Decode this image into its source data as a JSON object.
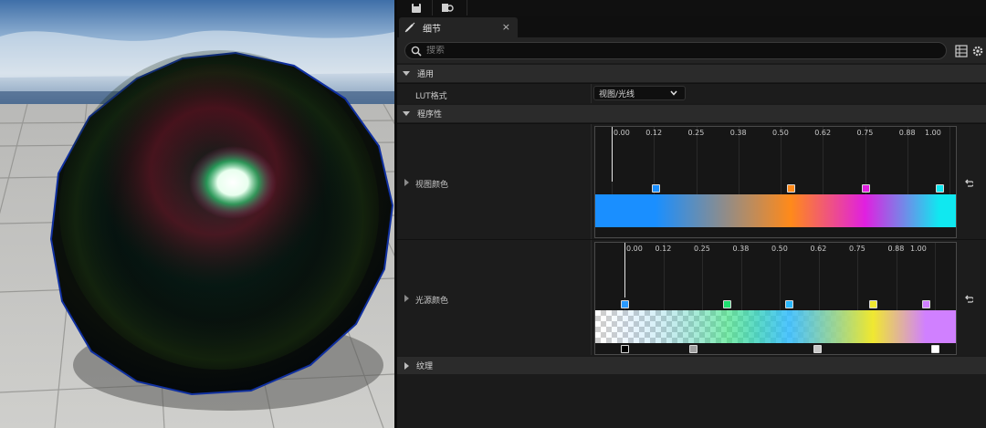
{
  "panel": {
    "tab_title": "细节",
    "tab_close": "×",
    "search_placeholder": "搜索"
  },
  "categories": {
    "general": "通用",
    "procedural": "程序性",
    "texture": "纹理"
  },
  "properties": {
    "lut_format": {
      "name": "LUT格式",
      "value": "视图/光线"
    },
    "view_color": {
      "name": "视图颜色",
      "ticks": [
        "0.00",
        "0.12",
        "0.25",
        "0.38",
        "0.50",
        "0.62",
        "0.75",
        "0.88",
        "1.00"
      ],
      "color_stops": [
        {
          "position": 0.13,
          "color": "#1a8fff"
        },
        {
          "position": 0.53,
          "color": "#ff8a1a"
        },
        {
          "position": 0.75,
          "color": "#e020e0"
        },
        {
          "position": 0.97,
          "color": "#10e8f0"
        }
      ]
    },
    "light_color": {
      "name": "光源颜色",
      "ticks": [
        "0.00",
        "0.12",
        "0.25",
        "0.38",
        "0.50",
        "0.62",
        "0.75",
        "0.88",
        "1.00"
      ],
      "color_stops": [
        {
          "position": 0.0,
          "color": "#2a9aff"
        },
        {
          "position": 0.33,
          "color": "#20e070"
        },
        {
          "position": 0.53,
          "color": "#28b8ff"
        },
        {
          "position": 0.8,
          "color": "#f0e830"
        },
        {
          "position": 0.97,
          "color": "#d080ff"
        }
      ],
      "alpha_stops": [
        {
          "position": 0.0,
          "color": "#000000"
        },
        {
          "position": 0.22,
          "color": "#a0a0a0"
        },
        {
          "position": 0.62,
          "color": "#c8c8c8"
        },
        {
          "position": 1.0,
          "color": "#ffffff"
        }
      ]
    }
  },
  "colors": {
    "accent_blue": "#1a8fff",
    "panel_bg": "#1b1b1b",
    "category_bg": "#2b2b2b"
  },
  "icons": {
    "save": "save-icon",
    "browse": "browse-icon",
    "details_tab": "details-brush-icon",
    "search": "search-icon",
    "grid": "grid-view-icon",
    "settings": "gear-icon",
    "reset": "reset-to-default-icon"
  }
}
